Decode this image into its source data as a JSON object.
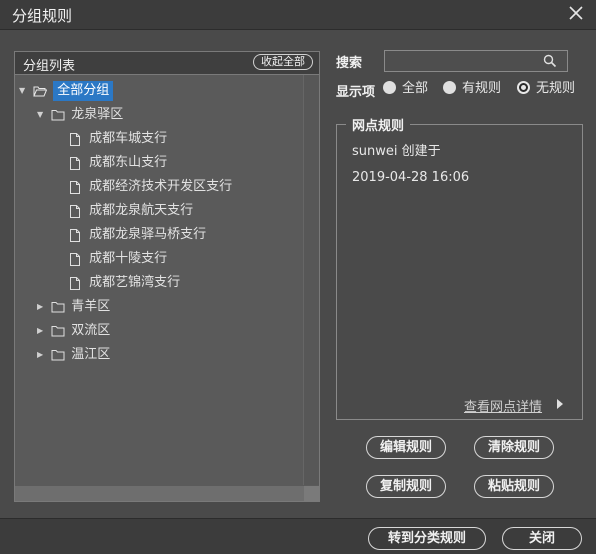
{
  "window": {
    "title": "分组规则",
    "close_icon": "close-icon"
  },
  "group_list": {
    "title": "分组列表",
    "collapse_all_label": "收起全部",
    "tree": {
      "root": {
        "label": "全部分组",
        "expanded": true,
        "selected": true
      },
      "districts": [
        {
          "label": "龙泉驿区",
          "expanded": true,
          "branches": [
            "成都车城支行",
            "成都东山支行",
            "成都经济技术开发区支行",
            "成都龙泉航天支行",
            "成都龙泉驿马桥支行",
            "成都十陵支行",
            "成都艺锦湾支行"
          ]
        },
        {
          "label": "青羊区",
          "expanded": false
        },
        {
          "label": "双流区",
          "expanded": false
        },
        {
          "label": "温江区",
          "expanded": false
        }
      ]
    }
  },
  "search": {
    "label": "搜索",
    "value": "",
    "icon": "search-icon"
  },
  "display_filter": {
    "label": "显示项",
    "options": [
      "全部",
      "有规则",
      "无规则"
    ],
    "selected": "无规则"
  },
  "branch_rule": {
    "legend": "网点规则",
    "creator_text": "sunwei 创建于",
    "created_time": "2019-04-28 16:06",
    "details_link": "查看网点详情"
  },
  "actions": {
    "edit_rule": "编辑规则",
    "clear_rule": "清除规则",
    "copy_rule": "复制规则",
    "paste_rule": "粘贴规则"
  },
  "footer": {
    "to_category_rule": "转到分类规则",
    "close": "关闭"
  },
  "colors": {
    "background": "#4a4a4a",
    "titlebar": "#3c3c3c",
    "selection": "#2b78c5",
    "panel": "#5a5a5a"
  }
}
